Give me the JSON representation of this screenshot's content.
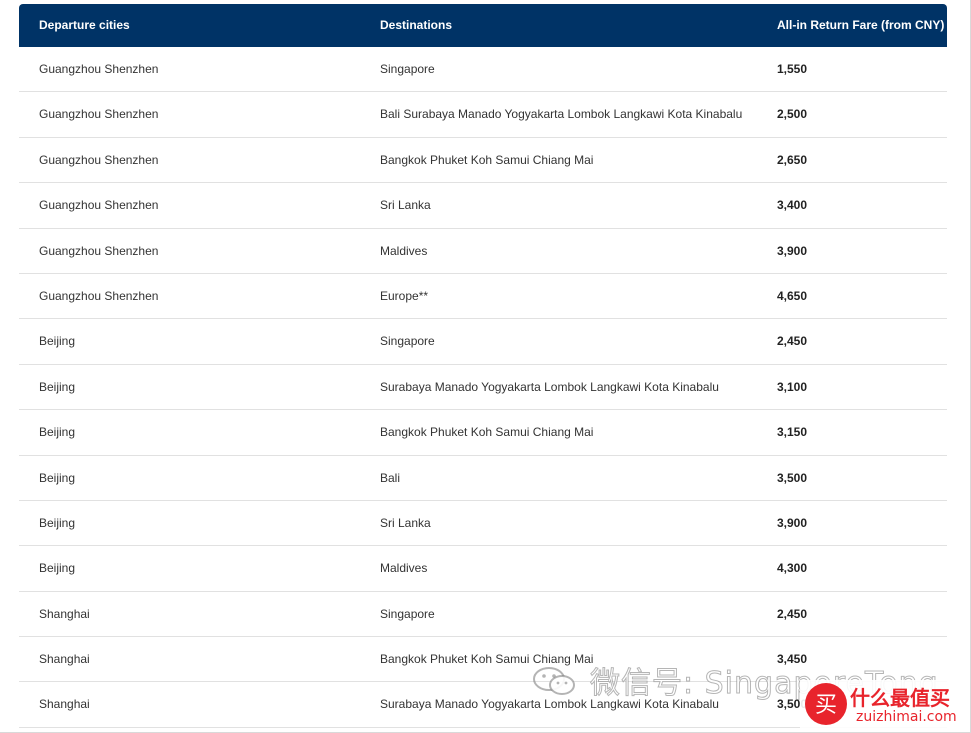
{
  "table": {
    "headers": {
      "departure": "Departure cities",
      "destinations": "Destinations",
      "fare": "All-in Return Fare (from CNY)"
    },
    "rows": [
      {
        "departure": "Guangzhou Shenzhen",
        "destinations": "Singapore",
        "fare": "1,550"
      },
      {
        "departure": "Guangzhou Shenzhen",
        "destinations": "Bali Surabaya Manado Yogyakarta Lombok Langkawi Kota Kinabalu",
        "fare": "2,500"
      },
      {
        "departure": "Guangzhou Shenzhen",
        "destinations": "Bangkok Phuket Koh Samui Chiang Mai",
        "fare": "2,650"
      },
      {
        "departure": "Guangzhou Shenzhen",
        "destinations": "Sri Lanka",
        "fare": "3,400"
      },
      {
        "departure": "Guangzhou Shenzhen",
        "destinations": "Maldives",
        "fare": "3,900"
      },
      {
        "departure": "Guangzhou Shenzhen",
        "destinations": "Europe**",
        "fare": "4,650"
      },
      {
        "departure": "Beijing",
        "destinations": "Singapore",
        "fare": "2,450"
      },
      {
        "departure": "Beijing",
        "destinations": "Surabaya Manado Yogyakarta Lombok Langkawi Kota Kinabalu",
        "fare": "3,100"
      },
      {
        "departure": "Beijing",
        "destinations": "Bangkok Phuket Koh Samui Chiang Mai",
        "fare": "3,150"
      },
      {
        "departure": "Beijing",
        "destinations": "Bali",
        "fare": "3,500"
      },
      {
        "departure": "Beijing",
        "destinations": "Sri Lanka",
        "fare": "3,900"
      },
      {
        "departure": "Beijing",
        "destinations": "Maldives",
        "fare": "4,300"
      },
      {
        "departure": "Shanghai",
        "destinations": "Singapore",
        "fare": "2,450"
      },
      {
        "departure": "Shanghai",
        "destinations": "Bangkok Phuket Koh Samui Chiang Mai",
        "fare": "3,450"
      },
      {
        "departure": "Shanghai",
        "destinations": "Surabaya Manado Yogyakarta Lombok Langkawi Kota Kinabalu",
        "fare": "3,500"
      }
    ]
  },
  "watermark": {
    "text": "微信号: SingaporeTong",
    "icon": "wechat-icon"
  },
  "logo": {
    "title": "什么最值买",
    "url": "zuizhimai.com",
    "badge_glyph": "买"
  },
  "colors": {
    "header_bg": "#003366",
    "header_text": "#ffffff",
    "logo_red": "#e8242c"
  }
}
